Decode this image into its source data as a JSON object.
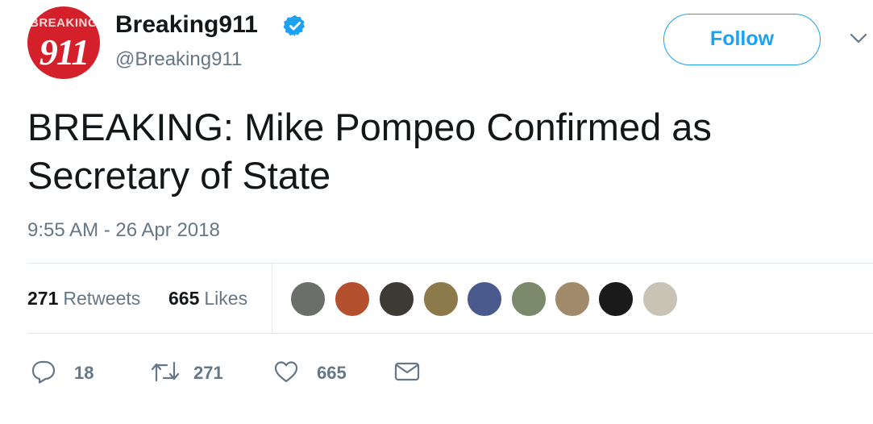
{
  "author": {
    "display_name": "Breaking911",
    "handle": "@Breaking911",
    "verified": true,
    "avatar_text_top": "BREAKING",
    "avatar_text_num": "911",
    "avatar_color": "#d4202a"
  },
  "follow_button": {
    "label": "Follow",
    "color": "#1da1f2"
  },
  "tweet": {
    "text": "BREAKING: Mike Pompeo Confirmed as Secretary of State",
    "timestamp": "9:55 AM - 26 Apr 2018"
  },
  "stats": {
    "retweets_count": "271",
    "retweets_label": "Retweets",
    "likes_count": "665",
    "likes_label": "Likes"
  },
  "likers_avatars": [
    {
      "name": "liker-1",
      "color": "#6b6f6a"
    },
    {
      "name": "liker-2",
      "color": "#b5502f"
    },
    {
      "name": "liker-3",
      "color": "#3d3a34"
    },
    {
      "name": "liker-4",
      "color": "#8c7a4a"
    },
    {
      "name": "liker-5",
      "color": "#4a5a8c"
    },
    {
      "name": "liker-6",
      "color": "#7a8a6a"
    },
    {
      "name": "liker-7",
      "color": "#a08a6a"
    },
    {
      "name": "liker-8",
      "color": "#1a1a1a"
    },
    {
      "name": "liker-9",
      "color": "#c9c3b5"
    }
  ],
  "actions": {
    "reply_count": "18",
    "retweet_count": "271",
    "like_count": "665"
  },
  "icons": [
    "verified-badge-icon",
    "chevron-down-icon",
    "reply-icon",
    "retweet-icon",
    "like-icon",
    "message-icon"
  ]
}
